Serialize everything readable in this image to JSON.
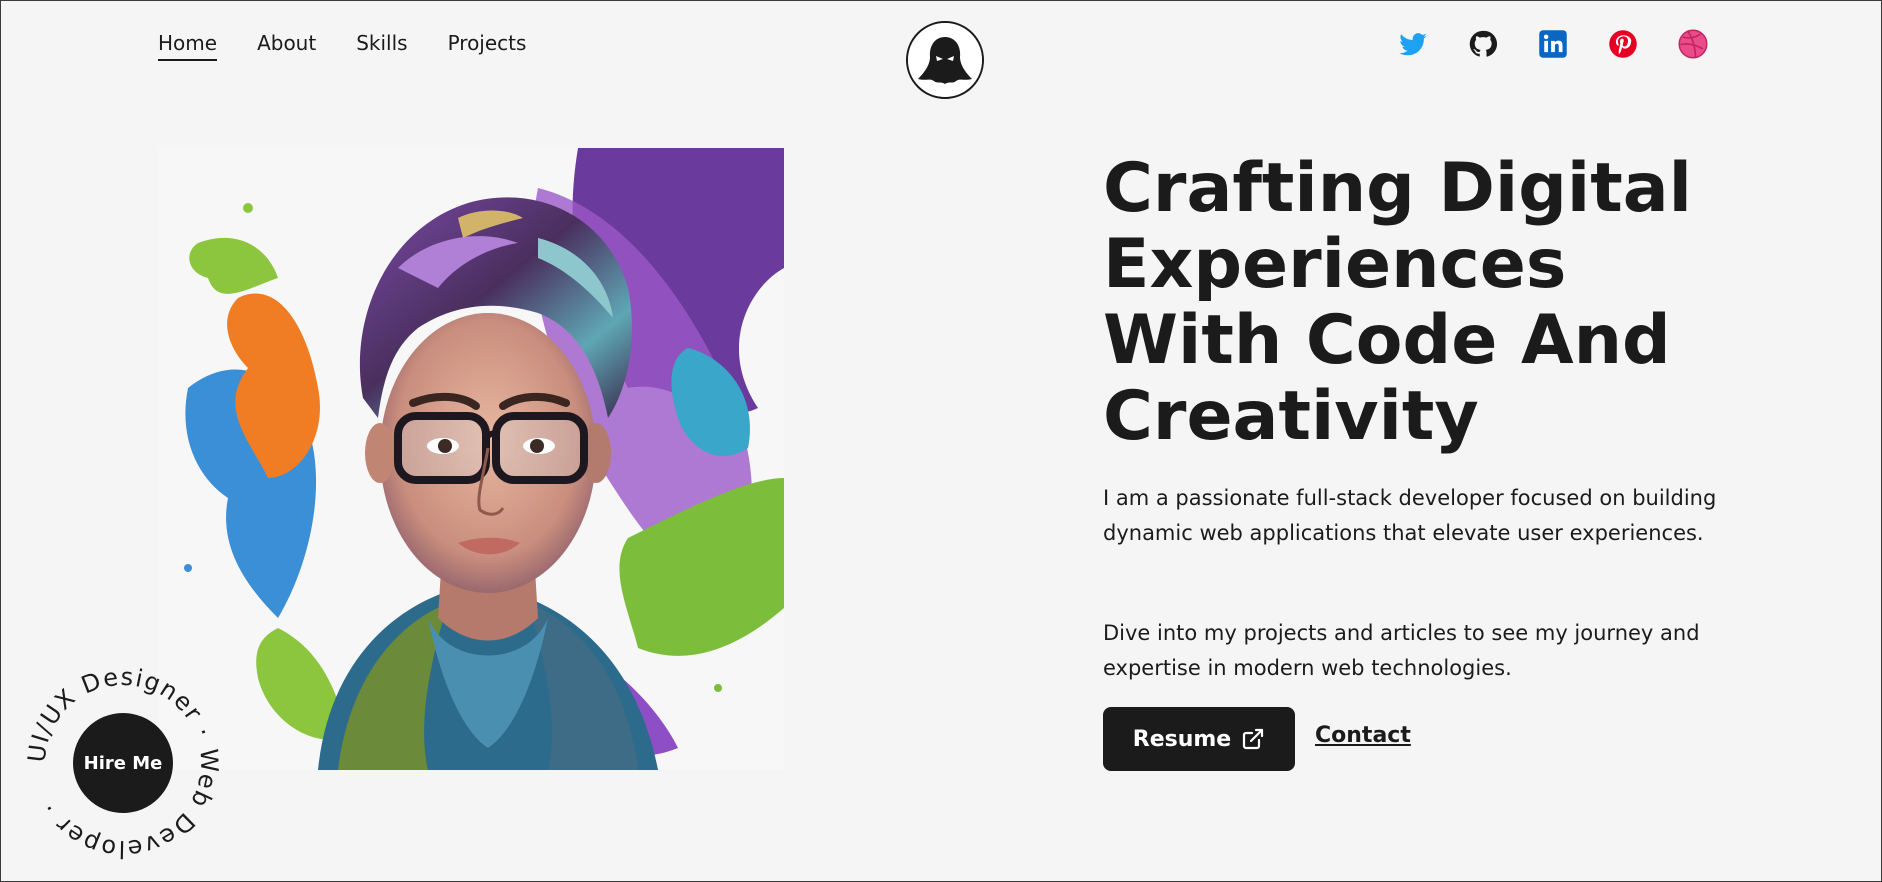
{
  "nav": {
    "items": [
      {
        "label": "Home",
        "active": true
      },
      {
        "label": "About",
        "active": false
      },
      {
        "label": "Skills",
        "active": false
      },
      {
        "label": "Projects",
        "active": false
      }
    ]
  },
  "logo": {
    "icon": "ghost-icon"
  },
  "socials": [
    {
      "icon": "twitter-icon",
      "color": "#1da1f2"
    },
    {
      "icon": "github-icon",
      "color": "#1b1b1b"
    },
    {
      "icon": "linkedin-icon",
      "color": "#0a66c2"
    },
    {
      "icon": "pinterest-icon",
      "color": "#e60023"
    },
    {
      "icon": "dribbble-icon",
      "color": "#ea4c89"
    }
  ],
  "hero": {
    "headline": "Crafting Digital Experiences With Code And Creativity",
    "paragraph1": "I am a passionate full-stack developer focused on building dynamic web applications that elevate user experiences.",
    "paragraph2": "Dive into my projects and articles to see my journey and expertise in modern web technologies.",
    "resume_label": "Resume",
    "contact_label": "Contact"
  },
  "hire": {
    "label": "Hire Me",
    "ring_text": "UI/UX Designer · Web Developer · "
  },
  "colors": {
    "background": "#f5f5f5",
    "text": "#1b1b1b",
    "button": "#1b1b1b"
  }
}
